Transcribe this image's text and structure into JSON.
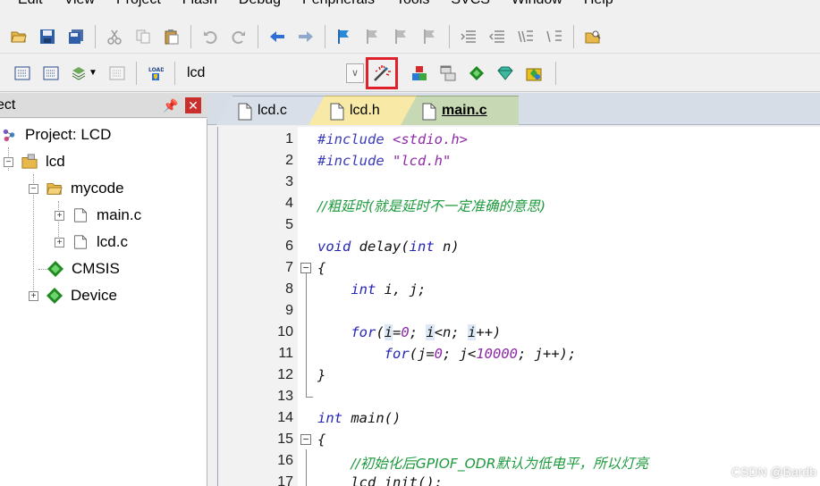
{
  "menubar": {
    "items": [
      "Edit",
      "View",
      "Project",
      "Flash",
      "Debug",
      "Peripherals",
      "Tools",
      "SVCS",
      "Window",
      "Help"
    ]
  },
  "toolbar2": {
    "target_value": "lcd"
  },
  "project_panel": {
    "title": "ect",
    "tree": {
      "root": "Project: LCD",
      "target": "lcd",
      "group": "mycode",
      "files": [
        "main.c",
        "lcd.c"
      ],
      "cmsis": "CMSIS",
      "device": "Device"
    }
  },
  "tabs": [
    "lcd.c",
    "lcd.h",
    "main.c"
  ],
  "editor": {
    "lines": [
      {
        "n": "1"
      },
      {
        "n": "2"
      },
      {
        "n": "3"
      },
      {
        "n": "4"
      },
      {
        "n": "5"
      },
      {
        "n": "6"
      },
      {
        "n": "7"
      },
      {
        "n": "8"
      },
      {
        "n": "9"
      },
      {
        "n": "10"
      },
      {
        "n": "11"
      },
      {
        "n": "12"
      },
      {
        "n": "13"
      },
      {
        "n": "14"
      },
      {
        "n": "15"
      },
      {
        "n": "16"
      },
      {
        "n": "17"
      }
    ],
    "code": {
      "l1_directive": "#include ",
      "l1_header": "<stdio.h>",
      "l2_directive": "#include ",
      "l2_header": "\"lcd.h\"",
      "l4_comment": "//粗延时(就是延时不一定准确的意思)",
      "l6_void": "void",
      "l6_name": " delay(",
      "l6_int": "int",
      "l6_rest": " n)",
      "l7": "{",
      "l8_int": "int",
      "l8_rest": " i, j;",
      "l10_for": "for",
      "l10_rest_a": "(",
      "l10_i1": "i",
      "l10_rest_b": "=",
      "l10_zero": "0",
      "l10_rest_c": "; ",
      "l10_i2": "i",
      "l10_rest_d": "<n; ",
      "l10_i3": "i",
      "l10_rest_e": "++)",
      "l11_for": "for",
      "l11_rest_a": "(j=",
      "l11_zero": "0",
      "l11_rest_b": "; j<",
      "l11_num": "10000",
      "l11_rest_c": "; j++);",
      "l12": "}",
      "l14_int": "int",
      "l14_rest": " main()",
      "l15": "{",
      "l16_comment": "//初始化后GPIOF_ODR默认为低电平，所以灯亮",
      "l17": "lcd_init();"
    }
  },
  "watermark": "CSDN @Bardb",
  "colors": {
    "highlight_box": "#e0202a",
    "comment": "#1d9a3d",
    "keyword": "#2626b5"
  }
}
